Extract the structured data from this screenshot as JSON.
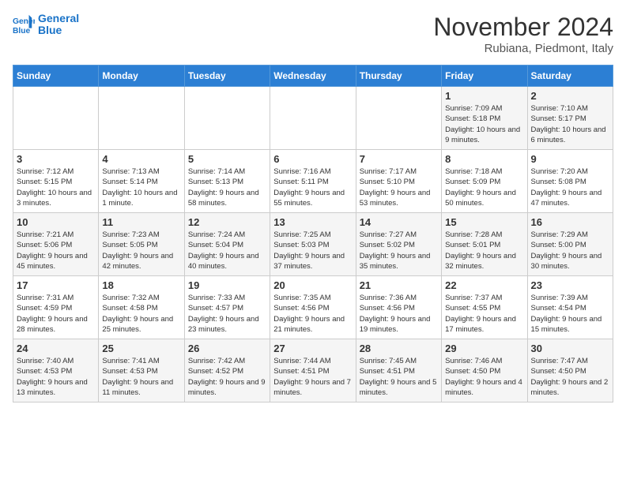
{
  "logo": {
    "line1": "General",
    "line2": "Blue"
  },
  "title": "November 2024",
  "subtitle": "Rubiana, Piedmont, Italy",
  "days_of_week": [
    "Sunday",
    "Monday",
    "Tuesday",
    "Wednesday",
    "Thursday",
    "Friday",
    "Saturday"
  ],
  "weeks": [
    [
      {
        "day": "",
        "info": ""
      },
      {
        "day": "",
        "info": ""
      },
      {
        "day": "",
        "info": ""
      },
      {
        "day": "",
        "info": ""
      },
      {
        "day": "",
        "info": ""
      },
      {
        "day": "1",
        "info": "Sunrise: 7:09 AM\nSunset: 5:18 PM\nDaylight: 10 hours and 9 minutes."
      },
      {
        "day": "2",
        "info": "Sunrise: 7:10 AM\nSunset: 5:17 PM\nDaylight: 10 hours and 6 minutes."
      }
    ],
    [
      {
        "day": "3",
        "info": "Sunrise: 7:12 AM\nSunset: 5:15 PM\nDaylight: 10 hours and 3 minutes."
      },
      {
        "day": "4",
        "info": "Sunrise: 7:13 AM\nSunset: 5:14 PM\nDaylight: 10 hours and 1 minute."
      },
      {
        "day": "5",
        "info": "Sunrise: 7:14 AM\nSunset: 5:13 PM\nDaylight: 9 hours and 58 minutes."
      },
      {
        "day": "6",
        "info": "Sunrise: 7:16 AM\nSunset: 5:11 PM\nDaylight: 9 hours and 55 minutes."
      },
      {
        "day": "7",
        "info": "Sunrise: 7:17 AM\nSunset: 5:10 PM\nDaylight: 9 hours and 53 minutes."
      },
      {
        "day": "8",
        "info": "Sunrise: 7:18 AM\nSunset: 5:09 PM\nDaylight: 9 hours and 50 minutes."
      },
      {
        "day": "9",
        "info": "Sunrise: 7:20 AM\nSunset: 5:08 PM\nDaylight: 9 hours and 47 minutes."
      }
    ],
    [
      {
        "day": "10",
        "info": "Sunrise: 7:21 AM\nSunset: 5:06 PM\nDaylight: 9 hours and 45 minutes."
      },
      {
        "day": "11",
        "info": "Sunrise: 7:23 AM\nSunset: 5:05 PM\nDaylight: 9 hours and 42 minutes."
      },
      {
        "day": "12",
        "info": "Sunrise: 7:24 AM\nSunset: 5:04 PM\nDaylight: 9 hours and 40 minutes."
      },
      {
        "day": "13",
        "info": "Sunrise: 7:25 AM\nSunset: 5:03 PM\nDaylight: 9 hours and 37 minutes."
      },
      {
        "day": "14",
        "info": "Sunrise: 7:27 AM\nSunset: 5:02 PM\nDaylight: 9 hours and 35 minutes."
      },
      {
        "day": "15",
        "info": "Sunrise: 7:28 AM\nSunset: 5:01 PM\nDaylight: 9 hours and 32 minutes."
      },
      {
        "day": "16",
        "info": "Sunrise: 7:29 AM\nSunset: 5:00 PM\nDaylight: 9 hours and 30 minutes."
      }
    ],
    [
      {
        "day": "17",
        "info": "Sunrise: 7:31 AM\nSunset: 4:59 PM\nDaylight: 9 hours and 28 minutes."
      },
      {
        "day": "18",
        "info": "Sunrise: 7:32 AM\nSunset: 4:58 PM\nDaylight: 9 hours and 25 minutes."
      },
      {
        "day": "19",
        "info": "Sunrise: 7:33 AM\nSunset: 4:57 PM\nDaylight: 9 hours and 23 minutes."
      },
      {
        "day": "20",
        "info": "Sunrise: 7:35 AM\nSunset: 4:56 PM\nDaylight: 9 hours and 21 minutes."
      },
      {
        "day": "21",
        "info": "Sunrise: 7:36 AM\nSunset: 4:56 PM\nDaylight: 9 hours and 19 minutes."
      },
      {
        "day": "22",
        "info": "Sunrise: 7:37 AM\nSunset: 4:55 PM\nDaylight: 9 hours and 17 minutes."
      },
      {
        "day": "23",
        "info": "Sunrise: 7:39 AM\nSunset: 4:54 PM\nDaylight: 9 hours and 15 minutes."
      }
    ],
    [
      {
        "day": "24",
        "info": "Sunrise: 7:40 AM\nSunset: 4:53 PM\nDaylight: 9 hours and 13 minutes."
      },
      {
        "day": "25",
        "info": "Sunrise: 7:41 AM\nSunset: 4:53 PM\nDaylight: 9 hours and 11 minutes."
      },
      {
        "day": "26",
        "info": "Sunrise: 7:42 AM\nSunset: 4:52 PM\nDaylight: 9 hours and 9 minutes."
      },
      {
        "day": "27",
        "info": "Sunrise: 7:44 AM\nSunset: 4:51 PM\nDaylight: 9 hours and 7 minutes."
      },
      {
        "day": "28",
        "info": "Sunrise: 7:45 AM\nSunset: 4:51 PM\nDaylight: 9 hours and 5 minutes."
      },
      {
        "day": "29",
        "info": "Sunrise: 7:46 AM\nSunset: 4:50 PM\nDaylight: 9 hours and 4 minutes."
      },
      {
        "day": "30",
        "info": "Sunrise: 7:47 AM\nSunset: 4:50 PM\nDaylight: 9 hours and 2 minutes."
      }
    ]
  ]
}
